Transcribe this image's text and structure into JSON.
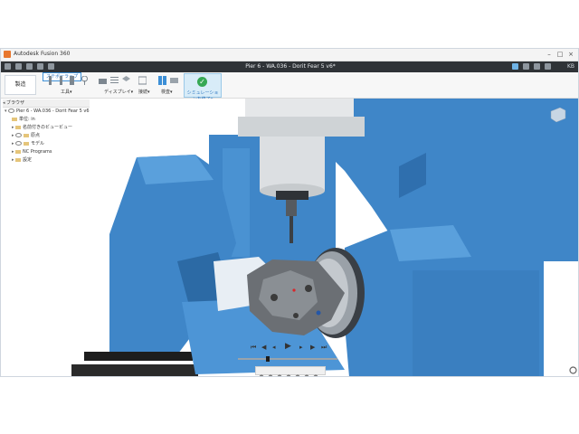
{
  "titlebar": {
    "app_title": "Autodesk Fusion 360",
    "minimize": "–",
    "maximize": "□",
    "close": "×"
  },
  "qa_toolbar": {
    "doc_title": "Pier 6 - WA.036 - Dorit Fear 5 v6*",
    "user_initials": "KB"
  },
  "ribbon": {
    "workspace_label": "製造",
    "tooltip": "ステポーラップ",
    "groups": [
      {
        "label": "工具▾"
      },
      {
        "label": "ディスプレイ▾"
      },
      {
        "label": "接続▾"
      },
      {
        "label": "検査▾"
      }
    ],
    "simulate": {
      "label": "シミュレーションを終了▾"
    }
  },
  "browser": {
    "title": "ブラウザ",
    "root": "Pier 6 - WA.036 - Dorit Fear 5 v6",
    "items": [
      {
        "label": "単位: in"
      },
      {
        "label": "名前付きのビュービュー"
      },
      {
        "label": "原点"
      },
      {
        "label": "モデル"
      },
      {
        "label": "NC Programs"
      },
      {
        "label": "設定"
      }
    ]
  },
  "colors": {
    "machine_blue": "#3f86c8",
    "accent": "#2d76c1",
    "sim_green": "#36a854"
  },
  "playback": {
    "first": "⏮",
    "prev": "◀",
    "stepback": "◂",
    "play": "▶",
    "stepfwd": "▸",
    "next": "▶",
    "last": "⏭",
    "progress": 0.3
  }
}
